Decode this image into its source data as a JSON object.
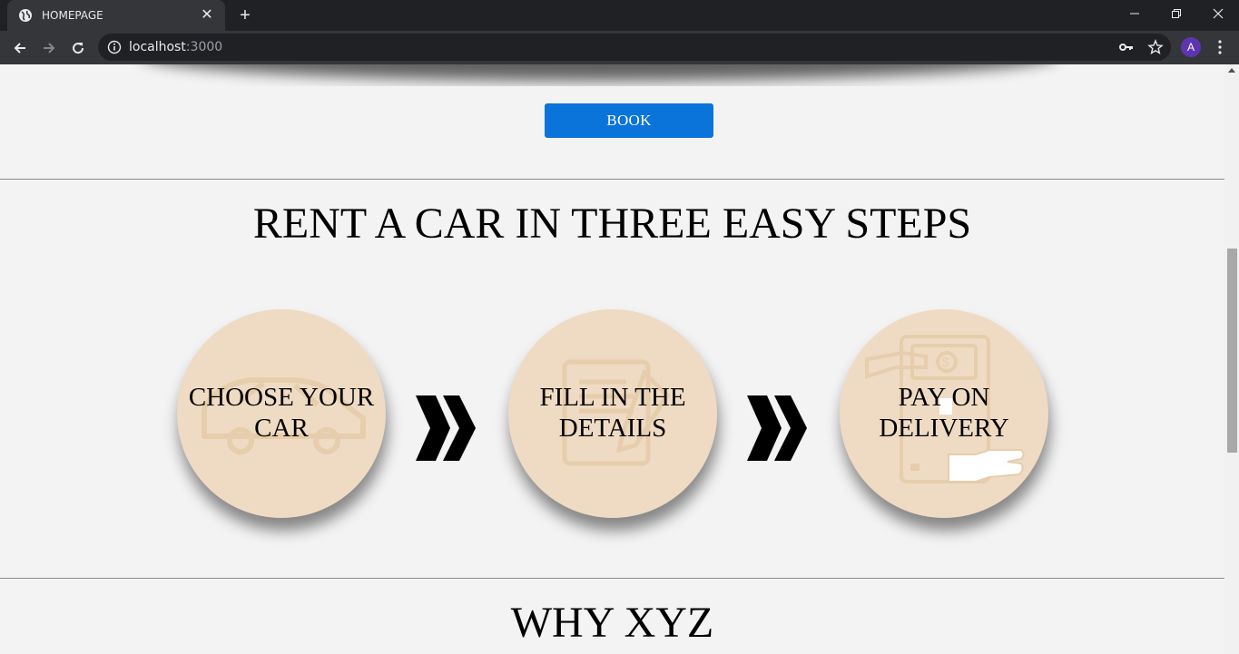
{
  "browser": {
    "tab_title": "HOMEPAGE",
    "url_host": "localhost",
    "url_port": ":3000",
    "profile_initial": "A"
  },
  "hero": {
    "book_label": "BOOK"
  },
  "steps": {
    "title": "RENT A CAR IN THREE EASY STEPS",
    "items": [
      {
        "label": "CHOOSE YOUR CAR",
        "icon": "car-icon"
      },
      {
        "label": "FILL IN THE DETAILS",
        "icon": "document-icon"
      },
      {
        "label": "PAY ON DELIVERY",
        "icon": "payment-hand-icon"
      }
    ]
  },
  "why": {
    "title": "WHY XYZ"
  },
  "colors": {
    "accent": "#0a74da",
    "circle": "#efdbc3",
    "page_bg": "#f3f3f3"
  }
}
